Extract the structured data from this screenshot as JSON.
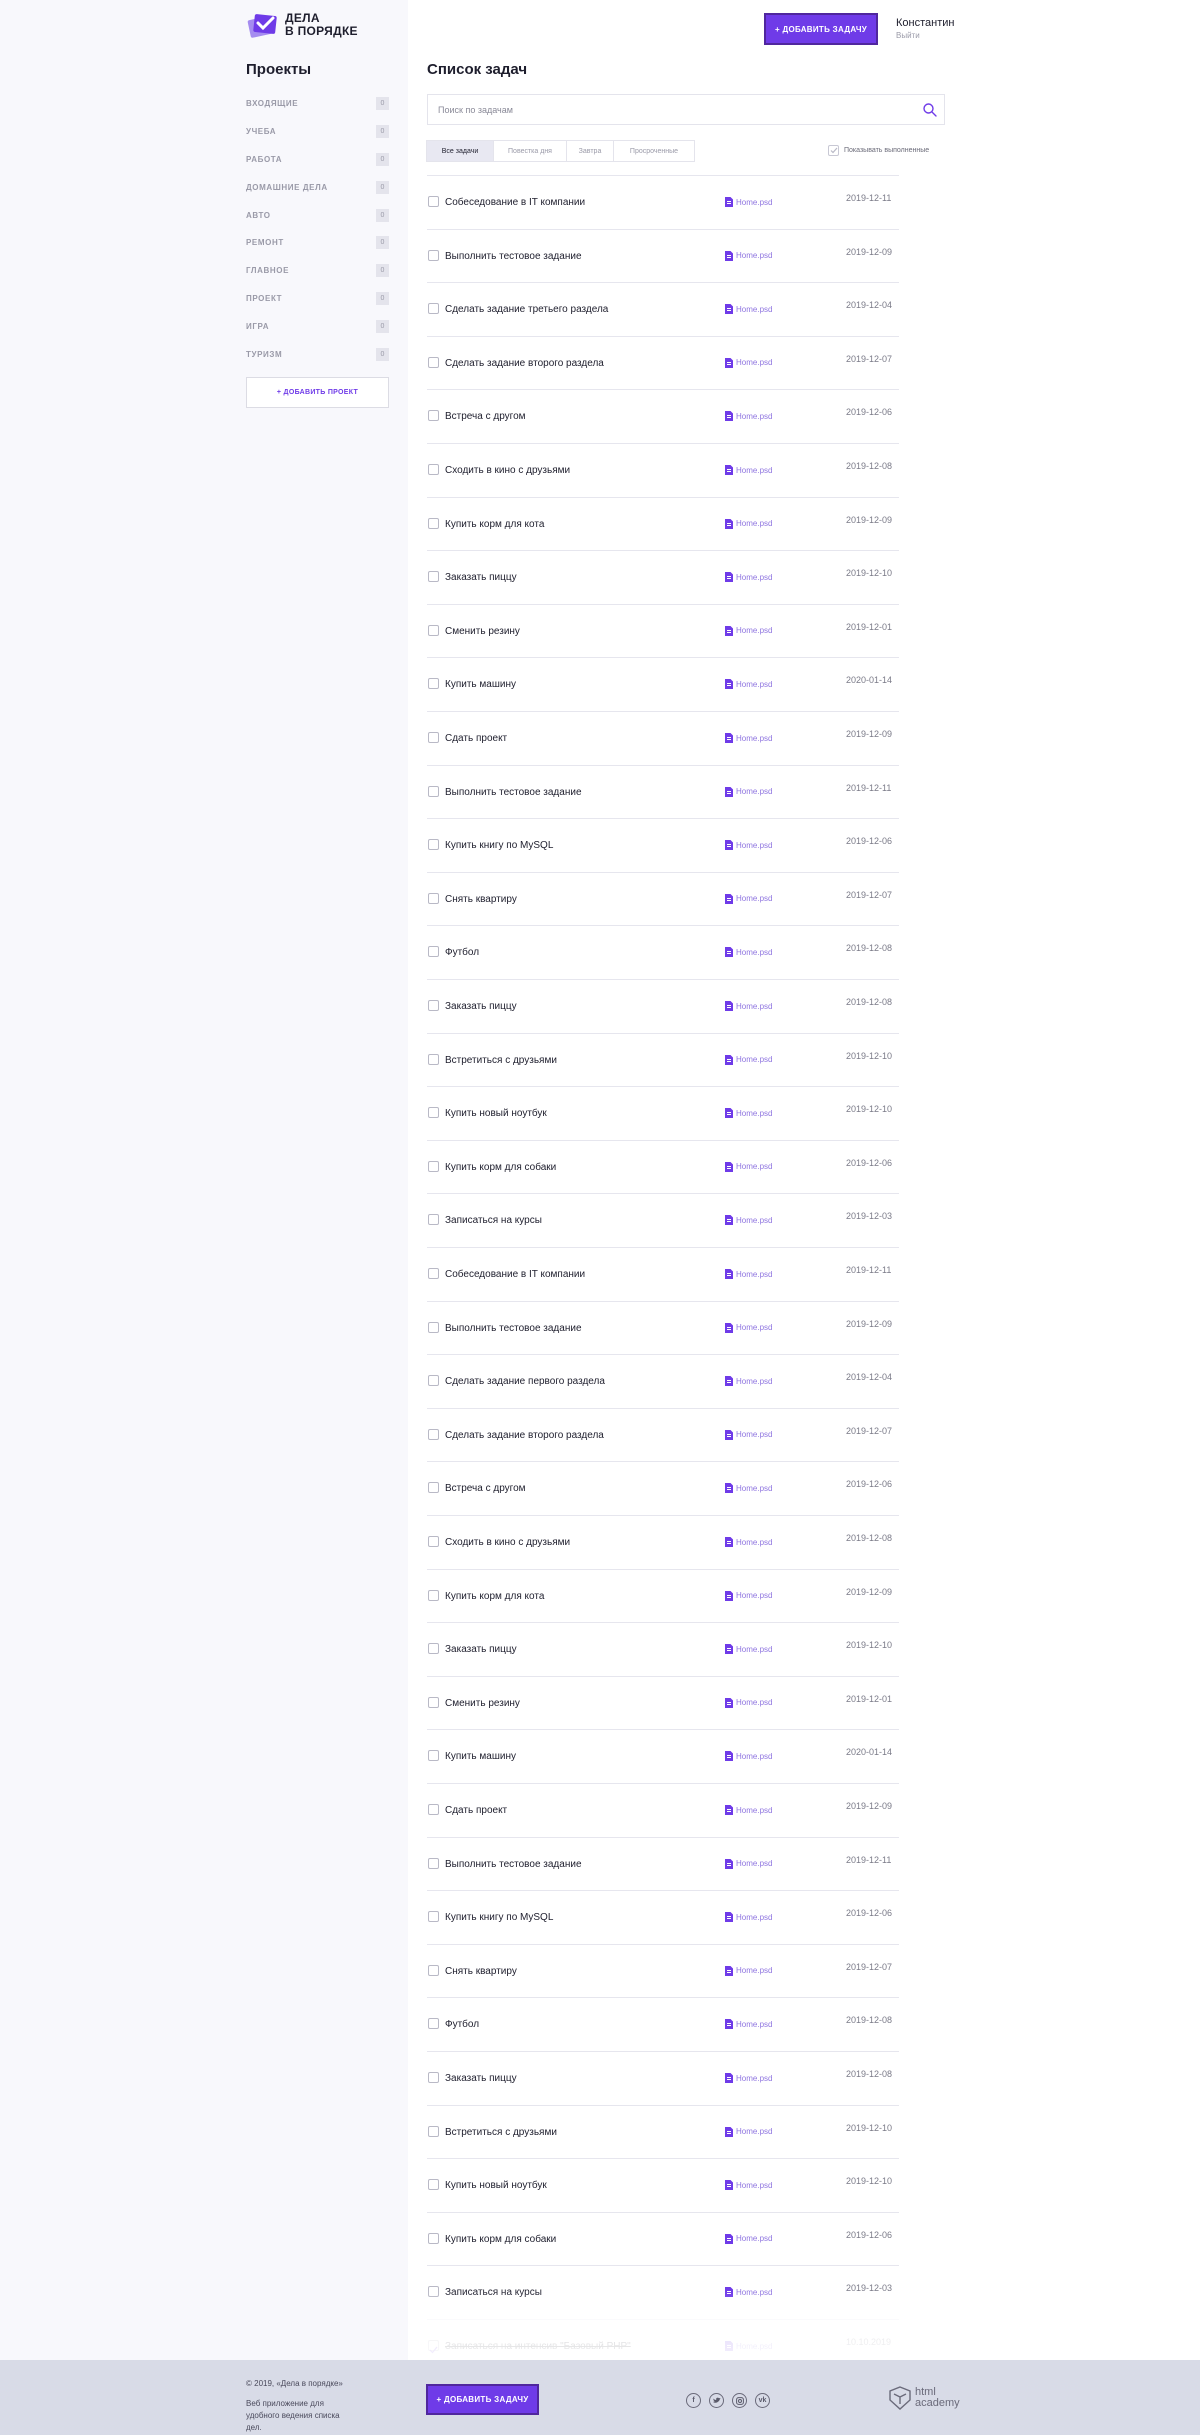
{
  "logo": {
    "line1": "Дела",
    "line2": "в порядке"
  },
  "header": {
    "add_task_label": "+ Добавить задачу",
    "user_name": "Константин",
    "logout_label": "Выйти"
  },
  "sidebar": {
    "title": "Проекты",
    "projects": [
      {
        "name": "Входящие",
        "count": "0"
      },
      {
        "name": "Учеба",
        "count": "0"
      },
      {
        "name": "Работа",
        "count": "0"
      },
      {
        "name": "Домашние дела",
        "count": "0"
      },
      {
        "name": "Авто",
        "count": "0"
      },
      {
        "name": "Ремонт",
        "count": "0"
      },
      {
        "name": "Главное",
        "count": "0"
      },
      {
        "name": "Проект",
        "count": "0"
      },
      {
        "name": "Игра",
        "count": "0"
      },
      {
        "name": "Туризм",
        "count": "0"
      }
    ],
    "add_project_label": "+ Добавить проект"
  },
  "main": {
    "title": "Список задач",
    "search_placeholder": "Поиск по задачам",
    "filters": [
      "Все задачи",
      "Повестка дня",
      "Завтра",
      "Просроченные"
    ],
    "active_filter": 0,
    "show_done_label": "Показывать выполненные",
    "tasks": [
      {
        "name": "Собеседование в IT компании",
        "file": "Home.psd",
        "date": "2019-12-11",
        "done": false
      },
      {
        "name": "Выполнить тестовое задание",
        "file": "Home.psd",
        "date": "2019-12-09",
        "done": false
      },
      {
        "name": "Сделать задание третьего раздела",
        "file": "Home.psd",
        "date": "2019-12-04",
        "done": false
      },
      {
        "name": "Сделать задание второго раздела",
        "file": "Home.psd",
        "date": "2019-12-07",
        "done": false
      },
      {
        "name": "Встреча с другом",
        "file": "Home.psd",
        "date": "2019-12-06",
        "done": false
      },
      {
        "name": "Сходить в кино с друзьями",
        "file": "Home.psd",
        "date": "2019-12-08",
        "done": false
      },
      {
        "name": "Купить корм для кота",
        "file": "Home.psd",
        "date": "2019-12-09",
        "done": false
      },
      {
        "name": "Заказать пиццу",
        "file": "Home.psd",
        "date": "2019-12-10",
        "done": false
      },
      {
        "name": "Сменить резину",
        "file": "Home.psd",
        "date": "2019-12-01",
        "done": false
      },
      {
        "name": "Купить машину",
        "file": "Home.psd",
        "date": "2020-01-14",
        "done": false
      },
      {
        "name": "Сдать проект",
        "file": "Home.psd",
        "date": "2019-12-09",
        "done": false
      },
      {
        "name": "Выполнить тестовое задание",
        "file": "Home.psd",
        "date": "2019-12-11",
        "done": false
      },
      {
        "name": "Купить книгу по MySQL",
        "file": "Home.psd",
        "date": "2019-12-06",
        "done": false
      },
      {
        "name": "Снять квартиру",
        "file": "Home.psd",
        "date": "2019-12-07",
        "done": false
      },
      {
        "name": "Футбол",
        "file": "Home.psd",
        "date": "2019-12-08",
        "done": false
      },
      {
        "name": "Заказать пиццу",
        "file": "Home.psd",
        "date": "2019-12-08",
        "done": false
      },
      {
        "name": "Встретиться с друзьями",
        "file": "Home.psd",
        "date": "2019-12-10",
        "done": false
      },
      {
        "name": "Купить новый ноутбук",
        "file": "Home.psd",
        "date": "2019-12-10",
        "done": false
      },
      {
        "name": "Купить корм для собаки",
        "file": "Home.psd",
        "date": "2019-12-06",
        "done": false
      },
      {
        "name": "Записаться на курсы",
        "file": "Home.psd",
        "date": "2019-12-03",
        "done": false
      },
      {
        "name": "Собеседование в IT компании",
        "file": "Home.psd",
        "date": "2019-12-11",
        "done": false
      },
      {
        "name": "Выполнить тестовое задание",
        "file": "Home.psd",
        "date": "2019-12-09",
        "done": false
      },
      {
        "name": "Сделать задание первого раздела",
        "file": "Home.psd",
        "date": "2019-12-04",
        "done": false
      },
      {
        "name": "Сделать задание второго раздела",
        "file": "Home.psd",
        "date": "2019-12-07",
        "done": false
      },
      {
        "name": "Встреча с другом",
        "file": "Home.psd",
        "date": "2019-12-06",
        "done": false
      },
      {
        "name": "Сходить в кино с друзьями",
        "file": "Home.psd",
        "date": "2019-12-08",
        "done": false
      },
      {
        "name": "Купить корм для кота",
        "file": "Home.psd",
        "date": "2019-12-09",
        "done": false
      },
      {
        "name": "Заказать пиццу",
        "file": "Home.psd",
        "date": "2019-12-10",
        "done": false
      },
      {
        "name": "Сменить резину",
        "file": "Home.psd",
        "date": "2019-12-01",
        "done": false
      },
      {
        "name": "Купить машину",
        "file": "Home.psd",
        "date": "2020-01-14",
        "done": false
      },
      {
        "name": "Сдать проект",
        "file": "Home.psd",
        "date": "2019-12-09",
        "done": false
      },
      {
        "name": "Выполнить тестовое задание",
        "file": "Home.psd",
        "date": "2019-12-11",
        "done": false
      },
      {
        "name": "Купить книгу по MySQL",
        "file": "Home.psd",
        "date": "2019-12-06",
        "done": false
      },
      {
        "name": "Снять квартиру",
        "file": "Home.psd",
        "date": "2019-12-07",
        "done": false
      },
      {
        "name": "Футбол",
        "file": "Home.psd",
        "date": "2019-12-08",
        "done": false
      },
      {
        "name": "Заказать пиццу",
        "file": "Home.psd",
        "date": "2019-12-08",
        "done": false
      },
      {
        "name": "Встретиться с друзьями",
        "file": "Home.psd",
        "date": "2019-12-10",
        "done": false
      },
      {
        "name": "Купить новый ноутбук",
        "file": "Home.psd",
        "date": "2019-12-10",
        "done": false
      },
      {
        "name": "Купить корм для собаки",
        "file": "Home.psd",
        "date": "2019-12-06",
        "done": false
      },
      {
        "name": "Записаться на курсы",
        "file": "Home.psd",
        "date": "2019-12-03",
        "done": false
      },
      {
        "name": "Записаться на интенсив \"Базовый PHP\"",
        "file": "Home.psd",
        "date": "10.10.2019",
        "done": true
      }
    ]
  },
  "footer": {
    "copyright": "© 2019, «Дела в порядке»",
    "description": "Веб приложение для удобного ведения списка дел.",
    "add_task_label": "+ Добавить задачу",
    "socials": [
      "facebook-icon",
      "twitter-icon",
      "instagram-icon",
      "vk-icon"
    ],
    "academy_line1": "html",
    "academy_line2": "academy"
  },
  "colors": {
    "accent": "#6f3be8",
    "accent_border": "#50279e",
    "sidebar_bg": "#f8f8fc",
    "footer_bg": "#d8dbe7"
  }
}
